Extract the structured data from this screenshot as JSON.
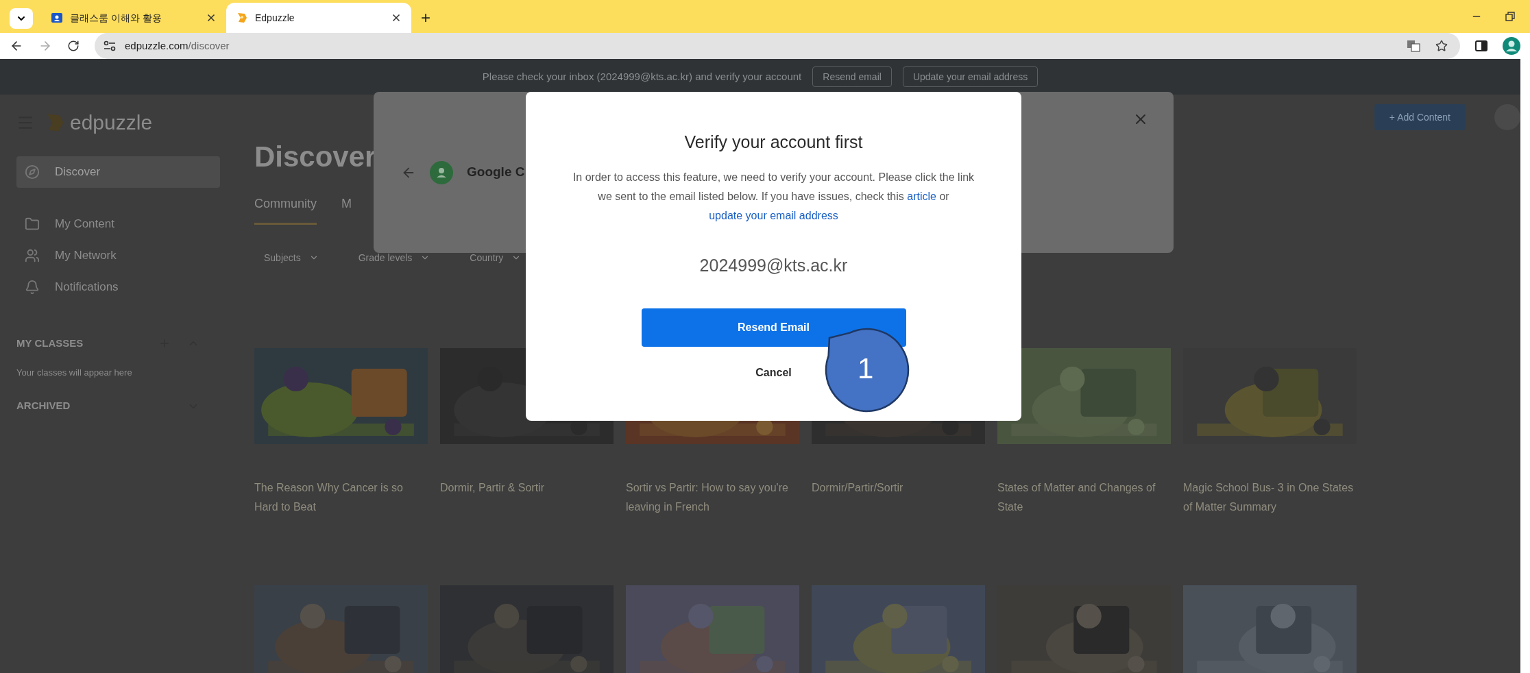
{
  "browser": {
    "tabs": [
      {
        "title": "클래스룸 이해와 활용",
        "selected": false
      },
      {
        "title": "Edpuzzle",
        "selected": true
      }
    ],
    "new_tab": "+",
    "url_host": "edpuzzle.com",
    "url_path": "/discover"
  },
  "banner": {
    "text": "Please check your inbox (2024999@kts.ac.kr) and verify your account",
    "buttons": [
      "Resend email",
      "Update your email address"
    ]
  },
  "app": {
    "logo": "edpuzzle",
    "add_content": "+ Add Content"
  },
  "sidebar": {
    "items": [
      {
        "label": "Discover",
        "selected": true
      },
      {
        "label": "My Content",
        "selected": false
      },
      {
        "label": "My Network",
        "selected": false
      },
      {
        "label": "Notifications",
        "selected": false
      }
    ],
    "classes_heading": "MY CLASSES",
    "classes_empty": "Your classes will appear here",
    "archived": "ARCHIVED"
  },
  "page": {
    "title": "Discover",
    "tabs": [
      {
        "label": "Community",
        "selected": true
      },
      {
        "label": "M",
        "selected": false
      }
    ],
    "filters": [
      "Subjects",
      "Grade levels",
      "Country"
    ]
  },
  "cards": [
    {
      "title": "The Reason Why Cancer is so Hard to Beat"
    },
    {
      "title": "Dormir, Partir & Sortir"
    },
    {
      "title": "Sortir vs Partir: How to say you're leaving in French"
    },
    {
      "title": "Dormir/Partir/Sortir"
    },
    {
      "title": "States of Matter and Changes of State"
    },
    {
      "title": "Magic School Bus- 3 in One States of Matter Summary"
    }
  ],
  "back_dialog": {
    "title": "Google C"
  },
  "dialog": {
    "title": "Verify your account first",
    "body": "In order to access this feature, we need to verify your account. Please click the link we sent to the email listed below. If you have issues, check this",
    "link_article": "article",
    "joiner": "or",
    "link_update": "update your email address",
    "email": "2024999@kts.ac.kr",
    "primary": "Resend Email",
    "secondary": "Cancel"
  },
  "callout": {
    "label": "1"
  }
}
